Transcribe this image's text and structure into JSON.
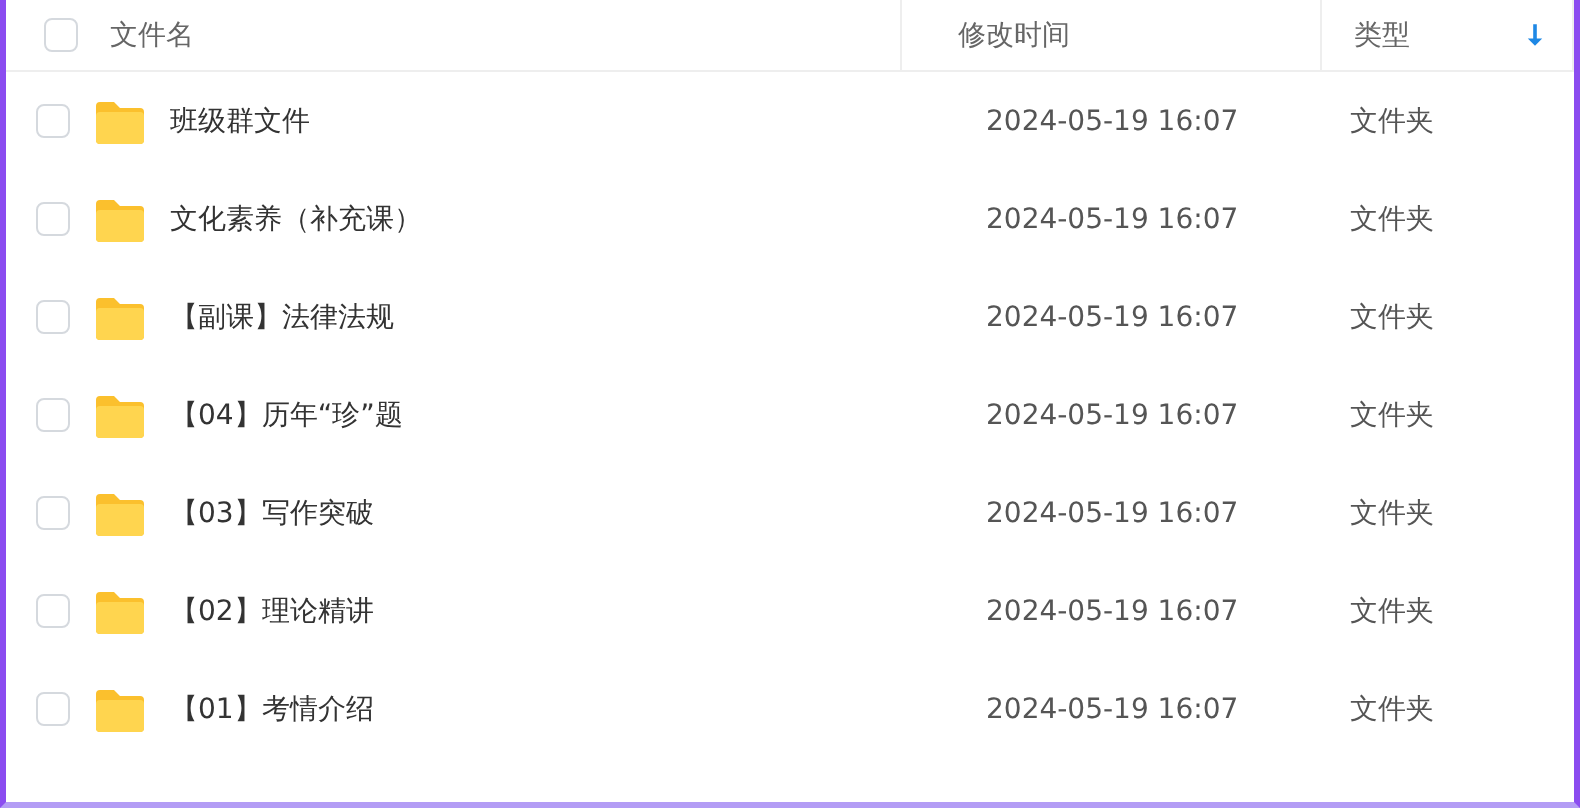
{
  "table": {
    "columns": [
      {
        "label": "文件名",
        "sort": false
      },
      {
        "label": "修改时间",
        "sort": false
      },
      {
        "label": "类型",
        "sort": true
      }
    ],
    "header_checked": false,
    "rows": [
      {
        "name": "班级群文件",
        "modified": "2024-05-19 16:07",
        "type": "文件夹",
        "checked": false
      },
      {
        "name": "文化素养（补充课）",
        "modified": "2024-05-19 16:07",
        "type": "文件夹",
        "checked": false
      },
      {
        "name": "【副课】法律法规",
        "modified": "2024-05-19 16:07",
        "type": "文件夹",
        "checked": false
      },
      {
        "name": "【04】历年“珍”题",
        "modified": "2024-05-19 16:07",
        "type": "文件夹",
        "checked": false
      },
      {
        "name": "【03】写作突破",
        "modified": "2024-05-19 16:07",
        "type": "文件夹",
        "checked": false
      },
      {
        "name": "【02】理论精讲",
        "modified": "2024-05-19 16:07",
        "type": "文件夹",
        "checked": false
      },
      {
        "name": "【01】考情介绍",
        "modified": "2024-05-19 16:07",
        "type": "文件夹",
        "checked": false
      }
    ]
  }
}
